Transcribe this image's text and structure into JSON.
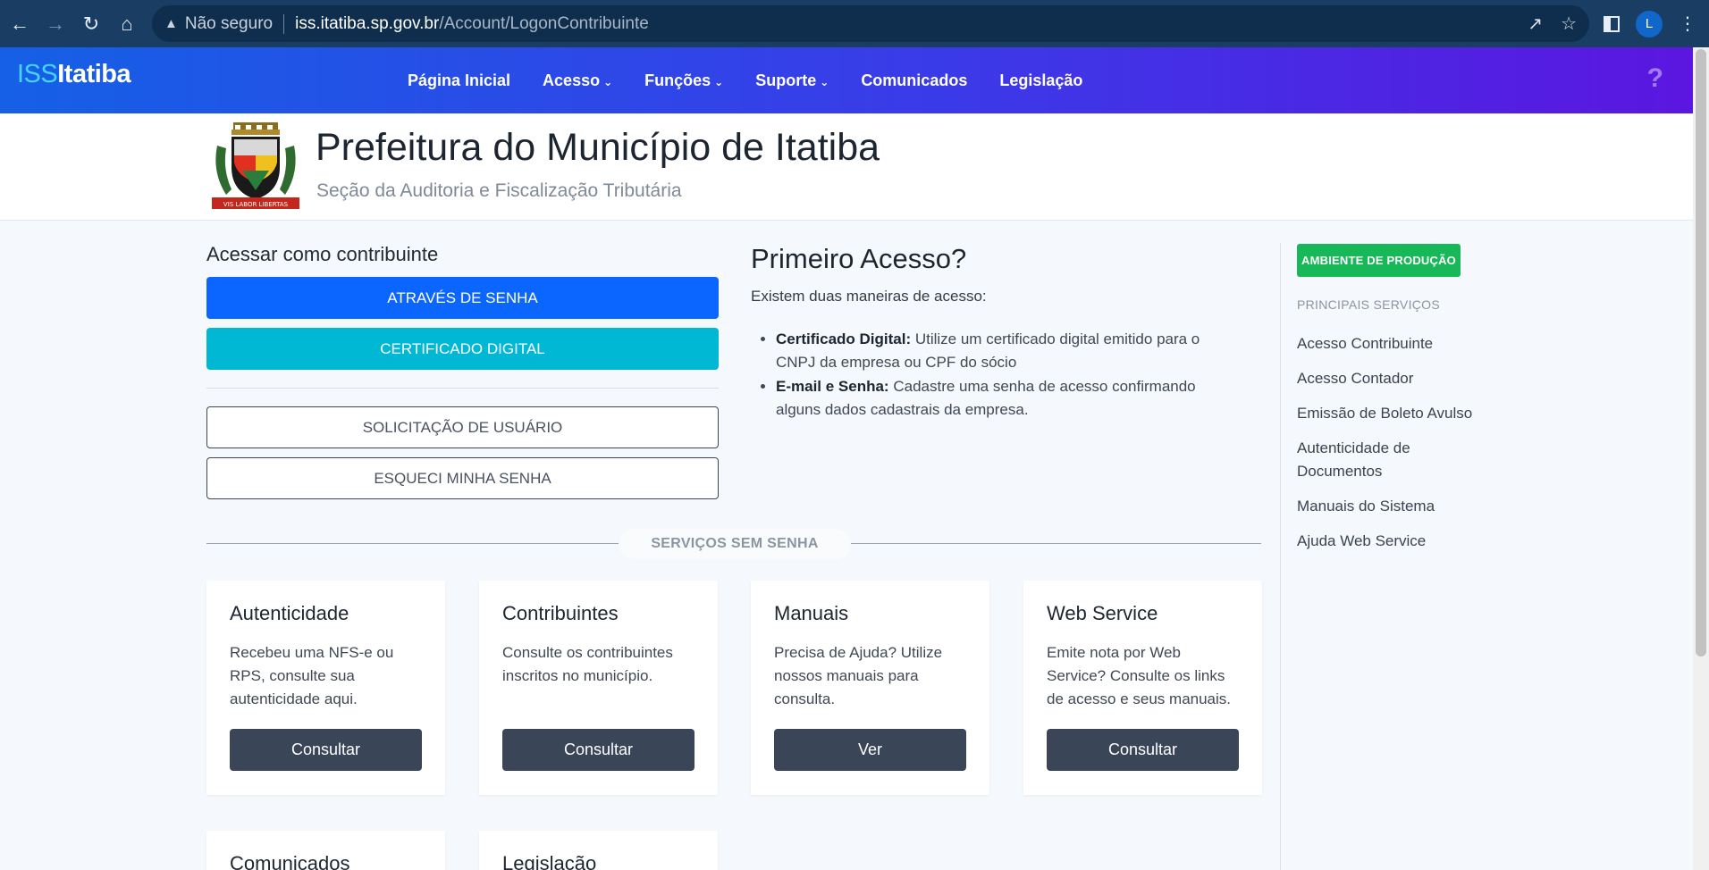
{
  "browser": {
    "security": "Não seguro",
    "url_host": "iss.itatiba.sp.gov.br",
    "url_path": "/Account/LogonContribuinte",
    "profile_initial": "L"
  },
  "site": {
    "logo_prefix": "ISS",
    "logo_name": "Itatiba",
    "nav": [
      {
        "label": "Página Inicial",
        "dropdown": false
      },
      {
        "label": "Acesso",
        "dropdown": true
      },
      {
        "label": "Funções",
        "dropdown": true
      },
      {
        "label": "Suporte",
        "dropdown": true
      },
      {
        "label": "Comunicados",
        "dropdown": false
      },
      {
        "label": "Legislação",
        "dropdown": false
      }
    ],
    "help_symbol": "?"
  },
  "brand": {
    "title": "Prefeitura do Município de Itatiba",
    "subtitle": "Seção da Auditoria e Fiscalização Tributária",
    "crest_motto": "VIS LABOR LIBERTAS"
  },
  "login": {
    "title": "Acessar como contribuinte",
    "btn_senha": "ATRAVÉS DE SENHA",
    "btn_certificado": "CERTIFICADO DIGITAL",
    "btn_solicitacao": "SOLICITAÇÃO DE USUÁRIO",
    "btn_esqueci": "ESQUECI MINHA SENHA"
  },
  "primeiro_acesso": {
    "title": "Primeiro Acesso?",
    "intro": "Existem duas maneiras de acesso:",
    "items": [
      {
        "label": "Certificado Digital:",
        "text": " Utilize um certificado digital emitido para o CNPJ da empresa ou CPF do sócio"
      },
      {
        "label": "E-mail e Senha:",
        "text": " Cadastre uma senha de acesso confirmando alguns dados cadastrais da empresa."
      }
    ]
  },
  "servicos": {
    "heading": "SERVIÇOS SEM SENHA",
    "cards": [
      {
        "title": "Autenticidade",
        "text": "Recebeu uma NFS-e ou RPS, consulte sua autenticidade aqui.",
        "button": "Consultar"
      },
      {
        "title": "Contribuintes",
        "text": "Consulte os contribuintes inscritos no município.",
        "button": "Consultar"
      },
      {
        "title": "Manuais",
        "text": "Precisa de Ajuda? Utilize nossos manuais para consulta.",
        "button": "Ver"
      },
      {
        "title": "Web Service",
        "text": "Emite nota por Web Service? Consulte os links de acesso e seus manuais.",
        "button": "Consultar"
      },
      {
        "title": "Comunicados"
      },
      {
        "title": "Legislação"
      }
    ]
  },
  "sidebar": {
    "badge": "AMBIENTE DE PRODUÇÃO",
    "heading": "PRINCIPAIS SERVIÇOS",
    "links": [
      "Acesso Contribuinte",
      "Acesso Contador",
      "Emissão de Boleto Avulso",
      "Autenticidade de Documentos",
      "Manuais do Sistema",
      "Ajuda Web Service"
    ]
  },
  "colors": {
    "header_start": "#1560e6",
    "header_end": "#5b16e0",
    "primary_button": "#0b66ff",
    "cert_button": "#00b8d4",
    "dark_button": "#3a4558",
    "production_badge": "#17b857"
  }
}
